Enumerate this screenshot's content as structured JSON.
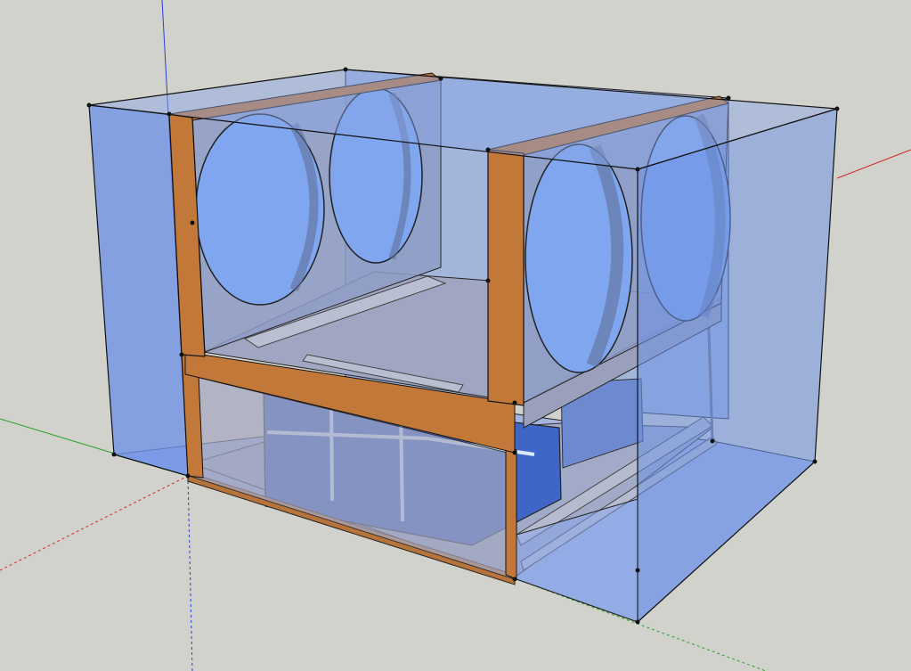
{
  "viewport": {
    "background": "#d2d2cc",
    "axis_colors": {
      "red": "#d22a2a",
      "green": "#27a327",
      "blue": "#2b3fd6"
    }
  },
  "model": {
    "enclosure_fill": "#6f93e6",
    "wood_color": "#c8783a",
    "panel_fill": "#8e9cc6",
    "hole_fill": "#7fa6ee",
    "battery_fill": "#3f66c6",
    "edge_color": "#121212"
  }
}
